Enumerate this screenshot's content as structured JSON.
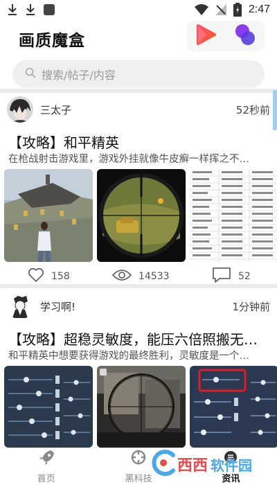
{
  "status_bar": {
    "time": "2:47"
  },
  "app": {
    "title": "画质魔盒"
  },
  "search": {
    "placeholder": "搜索/帖子/内容"
  },
  "posts": [
    {
      "author": "三太子",
      "time_ago": "52秒前",
      "title": "【攻略】和平精英",
      "summary": "在枪战射击游戏里，游戏外挂就像牛皮癣一样挥之不…",
      "stats": {
        "likes": "158",
        "views": "14533",
        "comments": "52"
      }
    },
    {
      "author": "学习啊!",
      "time_ago": "1分钟前",
      "title": "【攻略】超稳灵敏度，能压六倍照搬无…",
      "summary": "和平精英中想要获得游戏的最终胜利，灵敏度是一个…"
    }
  ],
  "tabs": [
    {
      "label": "首页",
      "icon": "rocket-icon"
    },
    {
      "label": "黑科技",
      "icon": "tools-icon"
    },
    {
      "label": "资讯",
      "icon": "news-icon"
    }
  ],
  "watermark": {
    "text1": "西西",
    "text2": "软件园"
  },
  "colors": {
    "accent_red": "#f0455c",
    "accent_purple": "#8a3cf0",
    "scroll": "#9ed0f5"
  }
}
